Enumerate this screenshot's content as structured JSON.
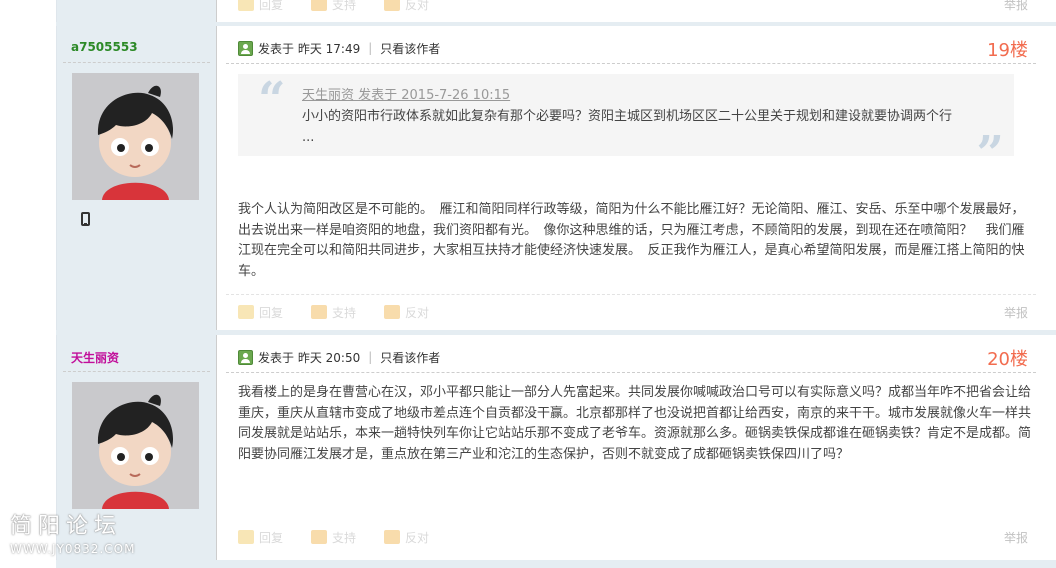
{
  "prev_post": {
    "actions": {
      "reply": "回复",
      "support": "支持",
      "oppose": "反对",
      "report": "举报"
    }
  },
  "posts": [
    {
      "username": "a7505553",
      "username_color": "#2d8a28",
      "posted_label": "发表于",
      "time": "昨天 17:49",
      "only_author": "只看该作者",
      "floor": "19楼",
      "quote": {
        "author_line": "天生丽资 发表于 2015-7-26 10:15",
        "text": "小小的资阳市行政体系就如此复杂有那个必要吗？资阳主城区到机场区区二十公里关于规划和建设就要协调两个行 ..."
      },
      "body": "我个人认为简阳改区是不可能的。　雁江和简阳同样行政等级，简阳为什么不能比雁江好？无论简阳、雁江、安岳、乐至中哪个发展最好，出去说出来一样是咱资阳的地盘，我们资阳都有光。　像你这种思维的话，只为雁江考虑，不顾简阳的发展，到现在还在喷简阳？　我们雁江现在完全可以和简阳共同进步，大家相互扶持才能使经济快速发展。　反正我作为雁江人，是真心希望简阳发展，而是雁江搭上简阳的快车。",
      "actions": {
        "reply": "回复",
        "support": "支持",
        "oppose": "反对",
        "report": "举报"
      },
      "device_icon": "mobile-icon"
    },
    {
      "username": "天生丽资",
      "username_color": "#c10e9a",
      "posted_label": "发表于",
      "time": "昨天 20:50",
      "only_author": "只看该作者",
      "floor": "20楼",
      "body": "我看楼上的是身在曹营心在汉，邓小平都只能让一部分人先富起来。共同发展你喊喊政治口号可以有实际意义吗？成都当年咋不把省会让给重庆，重庆从直辖市变成了地级市差点连个自贡都没干赢。北京都那样了也没说把首都让给西安，南京的来干干。城市发展就像火车一样共同发展就是站站乐，本来一趟特快列车你让它站站乐那不变成了老爷车。资源就那么多。砸锅卖铁保成都谁在砸锅卖铁？肯定不是成都。简阳要协同雁江发展才是，重点放在第三产业和沱江的生态保护，否则不就变成了成都砸锅卖铁保四川了吗？",
      "actions": {
        "reply": "回复",
        "support": "支持",
        "oppose": "反对",
        "report": "举报"
      }
    }
  ],
  "watermark": {
    "title": "简阳论坛",
    "url": "WWW.JY0832.COM"
  }
}
